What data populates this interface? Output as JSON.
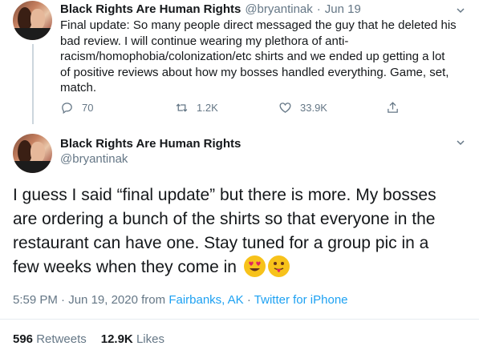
{
  "first_tweet": {
    "display_name": "Black Rights Are Human Rights",
    "handle": "@bryantinak",
    "separator": "·",
    "date": "Jun 19",
    "text": "Final update: So many people direct messaged the guy that he deleted his bad review. I will continue wearing my plethora of anti-racism/homophobia/colonization/etc shirts and we ended up getting a lot of positive reviews about how my bosses handled everything. Game, set, match.",
    "lines": [
      "Final update: So many people direct messaged the guy that he deleted his",
      "bad review. I will continue wearing my plethora of anti-",
      "racism/homophobia/colonization/etc shirts and we ended up getting a lot",
      "of positive reviews about how my bosses handled everything. Game, set,",
      "match."
    ],
    "actions": {
      "reply_count": "70",
      "retweet_count": "1.2K",
      "like_count": "33.9K",
      "reply_icon": "reply-icon",
      "retweet_icon": "retweet-icon",
      "like_icon": "heart-icon",
      "share_icon": "share-icon"
    }
  },
  "main_tweet": {
    "display_name": "Black Rights Are Human Rights",
    "handle": "@bryantinak",
    "lines": [
      "I guess I said “final update” but there is more. My bosses",
      "are ordering a bunch of the shirts so that everyone in the",
      "restaurant can have one. Stay tuned for a group pic in a",
      "few weeks when they come in"
    ],
    "emojis": [
      "heart-eyes-emoji",
      "tongue-out-emoji"
    ],
    "time": "5:59 PM",
    "dot": "·",
    "date": "Jun 19, 2020",
    "from_label": "from",
    "location": "Fairbanks, AK",
    "client": "Twitter for iPhone",
    "stats": {
      "retweets_num": "596",
      "retweets_label": "Retweets",
      "likes_num": "12.9K",
      "likes_label": "Likes"
    }
  },
  "colors": {
    "text": "#14171a",
    "secondary": "#657786",
    "link": "#1da1f2",
    "divider": "#e6ecf0"
  }
}
